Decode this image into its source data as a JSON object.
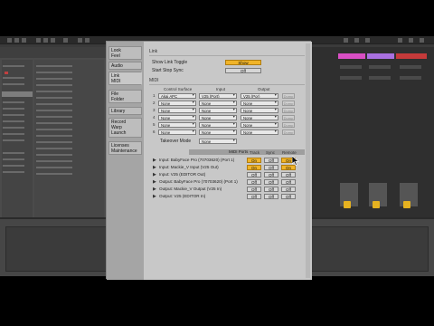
{
  "prefs": {
    "tabs": [
      {
        "label": "Look\nFeel"
      },
      {
        "label": "Audio"
      },
      {
        "label": "Link\nMIDI"
      },
      {
        "label": "File\nFolder"
      },
      {
        "label": "Library"
      },
      {
        "label": "Record\nWarp\nLaunch"
      },
      {
        "label": "Licenses\nMaintenance"
      }
    ],
    "link": {
      "section": "Link",
      "show_toggle_label": "Show Link Toggle",
      "show_toggle_value": "Show",
      "start_stop_label": "Start Stop Sync",
      "start_stop_value": "Off"
    },
    "midi": {
      "section": "MIDI",
      "col_surface": "Control Surface",
      "col_input": "Input",
      "col_output": "Output",
      "rows": [
        {
          "n": "1",
          "surface": "Akai APC",
          "input": "V25 (Port)",
          "output": "V25 (Por)",
          "edit": "Dump"
        },
        {
          "n": "2",
          "surface": "None",
          "input": "None",
          "output": "None",
          "edit": "Dump"
        },
        {
          "n": "3",
          "surface": "None",
          "input": "None",
          "output": "None",
          "edit": "Dump"
        },
        {
          "n": "4",
          "surface": "None",
          "input": "None",
          "output": "None",
          "edit": "Dump"
        },
        {
          "n": "5",
          "surface": "None",
          "input": "None",
          "output": "None",
          "edit": "Dump"
        },
        {
          "n": "6",
          "surface": "None",
          "input": "None",
          "output": "None",
          "edit": "Dump"
        }
      ],
      "takeover_label": "Takeover Mode",
      "takeover_value": "None"
    },
    "ports": {
      "head": "MIDI Ports",
      "col_track": "Track",
      "col_sync": "Sync",
      "col_remote": "Remote",
      "rows": [
        {
          "arrow": "▶",
          "text": "Input:   BabyFace Pro (70703620) (Port 1)",
          "track": "On",
          "sync": "Off",
          "remote": "On"
        },
        {
          "arrow": "▶",
          "text": "Input:   Mackie_V Input (V25 Out)",
          "track": "On",
          "sync": "Off",
          "remote": "On"
        },
        {
          "arrow": "▶",
          "text": "Input:   V25 (EDITOR Out)",
          "track": "Off",
          "sync": "Off",
          "remote": "Off"
        },
        {
          "arrow": "▶",
          "text": "Output: BabyFace Pro (70703620) (Port 1)",
          "track": "Off",
          "sync": "Off",
          "remote": "Off"
        },
        {
          "arrow": "▶",
          "text": "Output: Mackie_V Output (V25 In)",
          "track": "Off",
          "sync": "Off",
          "remote": "Off"
        },
        {
          "arrow": "▶",
          "text": "Output: V25 (EDITOR In)",
          "track": "Off",
          "sync": "Off",
          "remote": "Off"
        }
      ]
    }
  },
  "colors": {
    "toggle_on": "#f0b429",
    "dialog_bg": "#c8c8c8"
  }
}
